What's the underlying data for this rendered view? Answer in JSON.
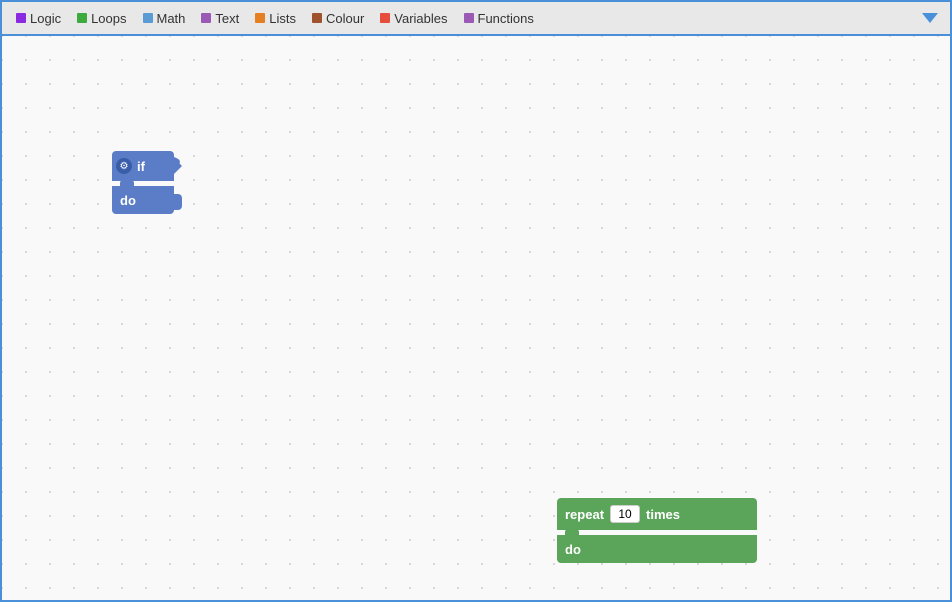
{
  "toolbar": {
    "items": [
      {
        "label": "Logic",
        "color": "#8a2be2",
        "colorName": "purple"
      },
      {
        "label": "Loops",
        "color": "#3daa3d",
        "colorName": "green"
      },
      {
        "label": "Math",
        "color": "#5b9bd5",
        "colorName": "blue"
      },
      {
        "label": "Text",
        "color": "#9b59b6",
        "colorName": "violet"
      },
      {
        "label": "Lists",
        "color": "#e67e22",
        "colorName": "orange"
      },
      {
        "label": "Colour",
        "color": "#a0522d",
        "colorName": "brown"
      },
      {
        "label": "Variables",
        "color": "#e74c3c",
        "colorName": "red"
      },
      {
        "label": "Functions",
        "color": "#9b59b6",
        "colorName": "purple"
      }
    ]
  },
  "blocks": {
    "if_block": {
      "top_label": "if",
      "bottom_label": "do"
    },
    "repeat_block": {
      "top_label": "repeat",
      "value": "10",
      "times_label": "times",
      "bottom_label": "do"
    }
  },
  "colors": {
    "border": "#4a90d9",
    "toolbar_bg": "#e8e8e8",
    "canvas_bg": "#f9f9f9",
    "dot_color": "#cccccc",
    "if_block": "#5b7dc8",
    "repeat_block": "#5ba55b",
    "arrow": "#4a90d9"
  },
  "icons": {
    "gear": "⚙",
    "dropdown_arrow": "▼"
  }
}
